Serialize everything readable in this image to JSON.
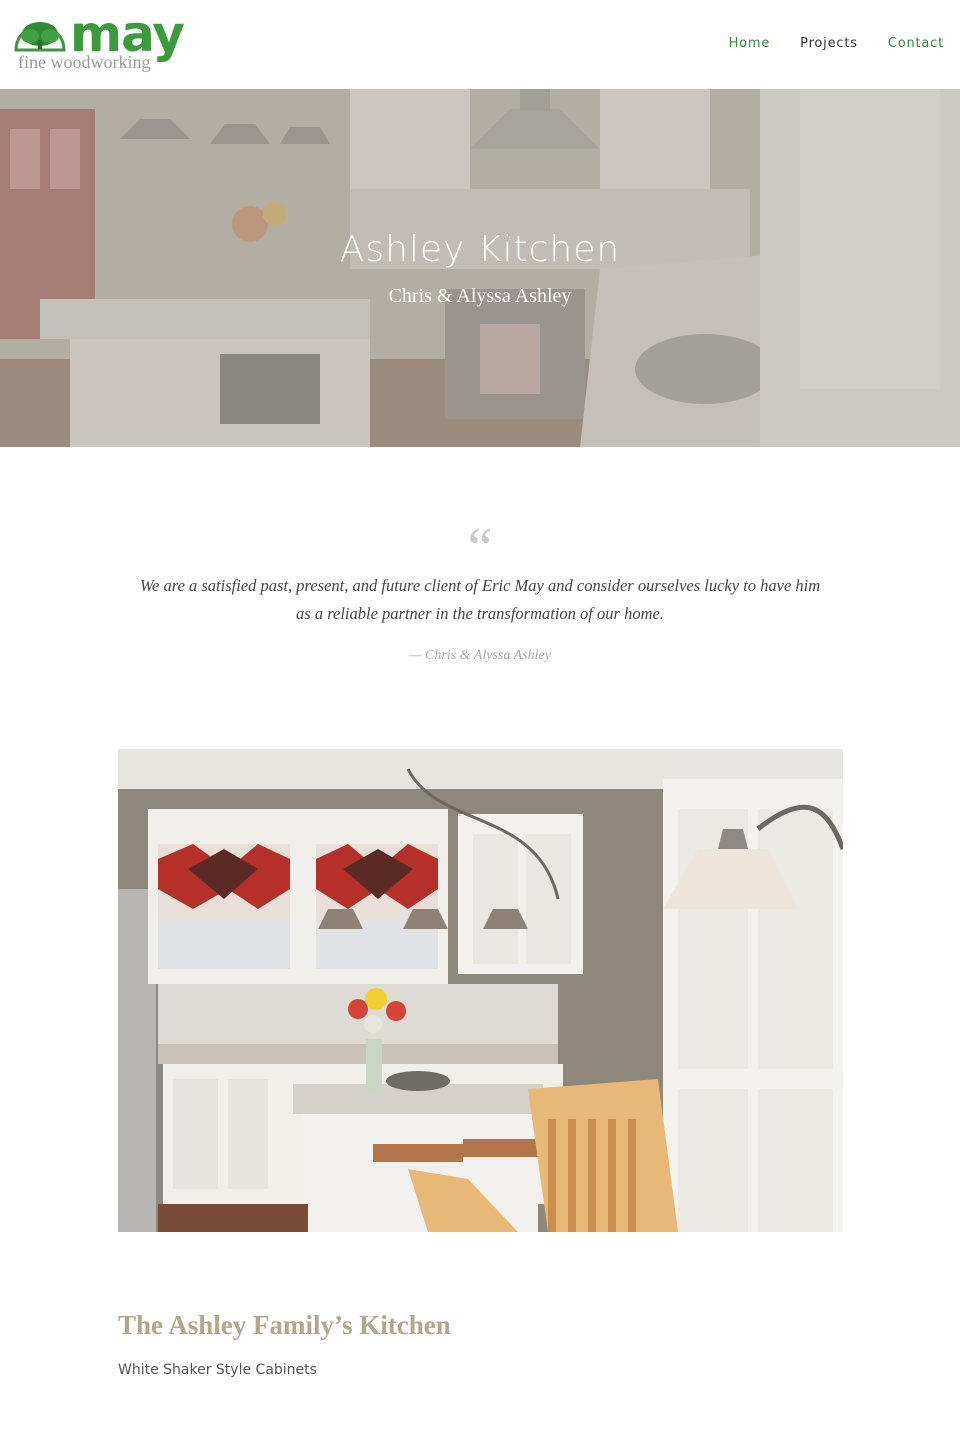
{
  "brand": {
    "name": "may",
    "tagline": "fine woodworking",
    "primary_color": "#3a9a3c"
  },
  "nav": {
    "items": [
      {
        "label": "Home",
        "active": true
      },
      {
        "label": "Projects",
        "active": false
      },
      {
        "label": "Contact",
        "active": false
      }
    ]
  },
  "hero": {
    "title": "Ashley Kitchen",
    "subtitle": "Chris & Alyssa Ashley"
  },
  "testimonial": {
    "mark": "“",
    "text": "We are a satisfied past, present, and future client of Eric May and consider ourselves lucky to have him as a reliable partner in the transformation of our home.",
    "author": "— Chris & Alyssa Ashley"
  },
  "project": {
    "title": "The Ashley Family’s Kitchen",
    "description": "White Shaker Style Cabinets"
  }
}
